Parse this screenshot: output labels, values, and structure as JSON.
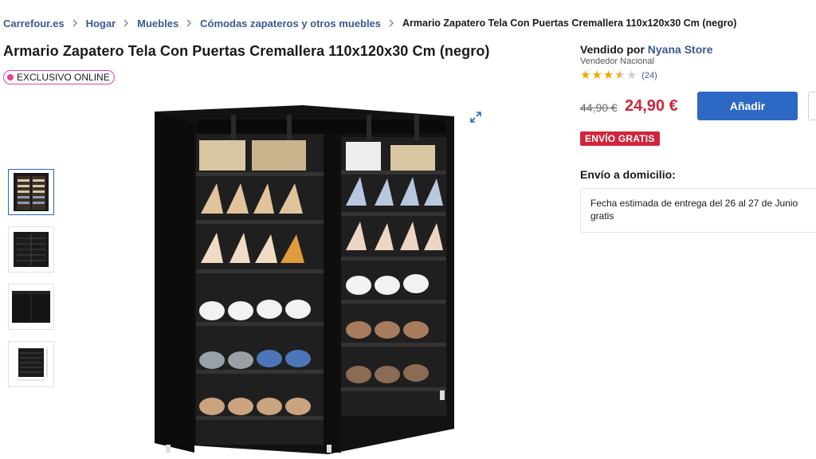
{
  "breadcrumb": {
    "items": [
      "Carrefour.es",
      "Hogar",
      "Muebles",
      "Cómodas zapateros y otros muebles"
    ],
    "current": "Armario Zapatero Tela Con Puertas Cremallera 110x120x30 Cm (negro)"
  },
  "product": {
    "title": "Armario Zapatero Tela Con Puertas Cremallera 110x120x30 Cm (negro)",
    "badge": "EXCLUSIVO ONLINE",
    "main_image_icon": "black-shoe-cabinet-image",
    "thumbnails": [
      "shoe-cabinet-open-thumbnail",
      "shoe-cabinet-empty-thumbnail",
      "shoe-cabinet-closed-thumbnail",
      "shoe-cabinet-dimensions-thumbnail"
    ]
  },
  "seller": {
    "prefix": "Vendido por",
    "name": "Nyana Store",
    "type": "Vendedor Nacional",
    "rating_stars": 3.5,
    "rating_max": 5,
    "rating_count": "(24)"
  },
  "pricing": {
    "old_price": "44,90 €",
    "new_price": "24,90 €",
    "add_label": "Añadir",
    "shipping_badge": "ENVÍO GRATIS"
  },
  "delivery": {
    "title": "Envío a domicilio:",
    "estimate": "Fecha estimada de entrega del 26 al 27 de Junio",
    "cost": "gratis"
  },
  "colors": {
    "link": "#3a5a8f",
    "primary_button": "#2d68c4",
    "price_red": "#d0253a",
    "badge_pink": "#e0449a",
    "star": "#f2a900"
  }
}
